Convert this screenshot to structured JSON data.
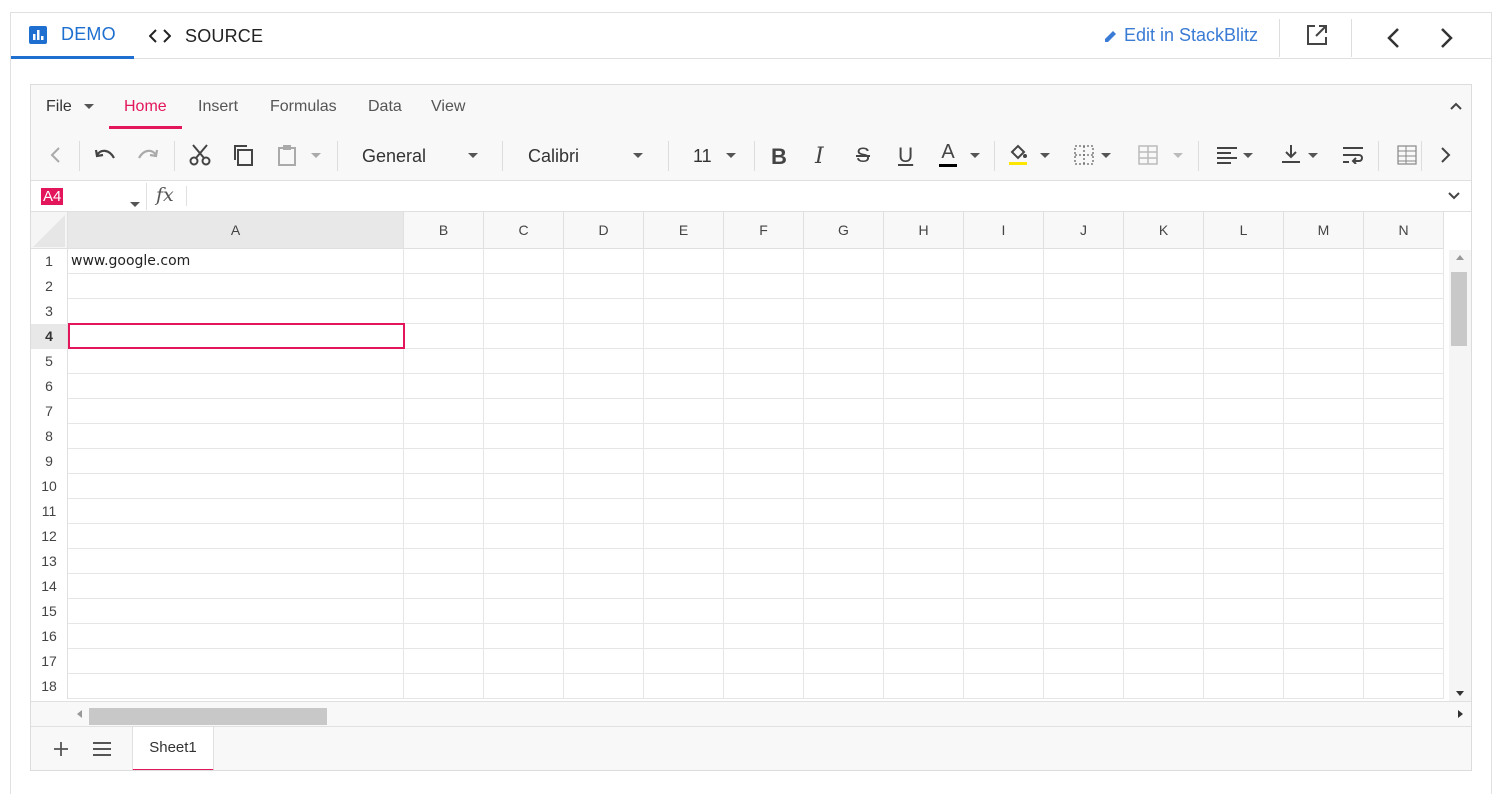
{
  "demo_header": {
    "demo_tab": "DEMO",
    "source_tab": "SOURCE",
    "edit_link": "Edit in StackBlitz"
  },
  "ribbon": {
    "file": "File",
    "tabs": [
      "Home",
      "Insert",
      "Formulas",
      "Data",
      "View"
    ],
    "active_tab": "Home"
  },
  "toolbar": {
    "number_format": "General",
    "font_name": "Calibri",
    "font_size": "11"
  },
  "formula_bar": {
    "name_box": "A4",
    "fx_label": "fx",
    "formula_value": ""
  },
  "grid": {
    "columns": [
      "A",
      "B",
      "C",
      "D",
      "E",
      "F",
      "G",
      "H",
      "I",
      "J",
      "K",
      "L",
      "M",
      "N"
    ],
    "rows": [
      "1",
      "2",
      "3",
      "4",
      "5",
      "6",
      "7",
      "8",
      "9",
      "10",
      "11",
      "12",
      "13",
      "14",
      "15",
      "16",
      "17",
      "18"
    ],
    "cells": {
      "A1": "www.google.com"
    },
    "active_cell": "A4",
    "selected_column": "A",
    "selected_row": "4"
  },
  "sheet_tabs": {
    "tabs": [
      "Sheet1"
    ],
    "active": "Sheet1"
  },
  "colors": {
    "accent": "#e3165b",
    "demo_blue": "#1e6fd0",
    "link_blue": "#3a7bd5"
  },
  "icons": [
    "chart-bar-icon",
    "code-icon",
    "pencil-icon",
    "open-external-icon",
    "chevron-left-icon",
    "chevron-right-icon",
    "collapse-icon",
    "undo-icon",
    "redo-icon",
    "cut-icon",
    "copy-icon",
    "paste-icon",
    "bold-icon",
    "italic-icon",
    "strikethrough-icon",
    "underline-icon",
    "font-color-icon",
    "fill-color-icon",
    "borders-icon",
    "merge-icon",
    "align-icon",
    "vertical-align-icon",
    "wrap-icon",
    "conditional-format-icon",
    "plus-icon",
    "menu-icon"
  ]
}
